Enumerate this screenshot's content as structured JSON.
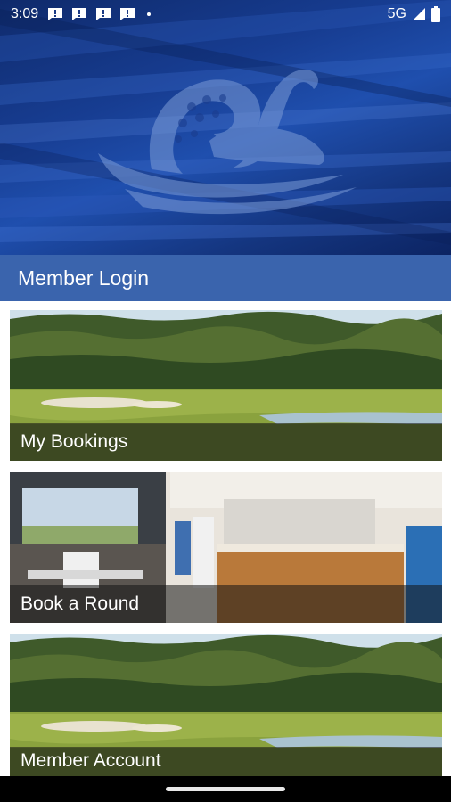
{
  "status_bar": {
    "time": "3:09",
    "network": "5G",
    "icons": [
      "message-icon",
      "message-icon",
      "message-icon",
      "message-icon",
      "dot-icon",
      "signal-icon",
      "battery-icon"
    ]
  },
  "header": {
    "logo": "swan-golf-ball-logo",
    "title": "Member Login"
  },
  "cards": [
    {
      "label": "My Bookings",
      "image": "golf course with trees and bunkers"
    },
    {
      "label": "Book a Round",
      "image": "clubhouse bar with patrons"
    },
    {
      "label": "Member Account",
      "image": "golf course with trees and bunkers"
    }
  ],
  "colors": {
    "header_gradient_dark": "#0f2a6b",
    "header_gradient_light": "#1f4fae",
    "title_band": "#3a64ad",
    "caption_overlay": "rgba(20,20,20,0.55)"
  }
}
